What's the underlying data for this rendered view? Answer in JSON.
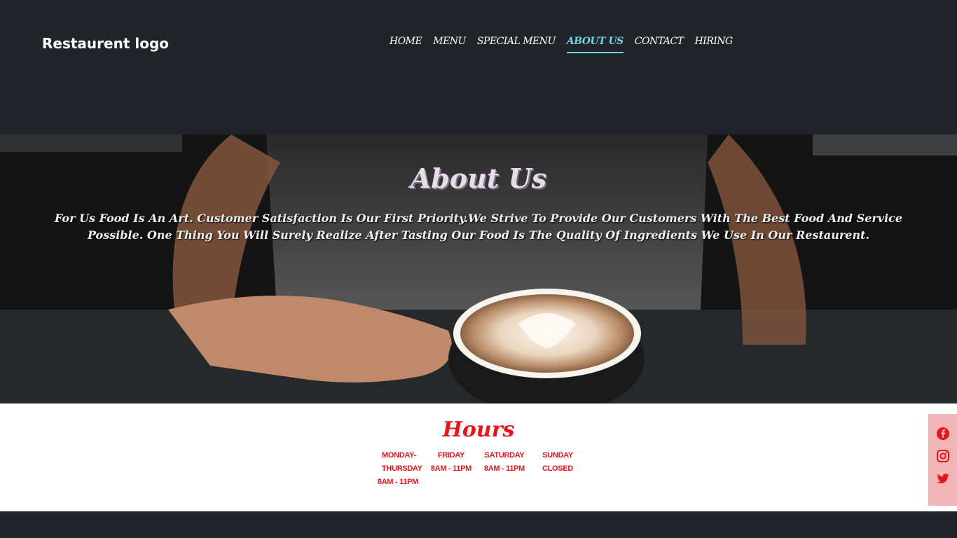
{
  "header": {
    "logo": "Restaurent logo",
    "nav": [
      {
        "label": "HOME"
      },
      {
        "label": "MENU"
      },
      {
        "label": "SPECIAL MENU"
      },
      {
        "label": "ABOUT US"
      },
      {
        "label": "CONTACT"
      },
      {
        "label": "HIRING"
      }
    ],
    "active_index": 3
  },
  "hero": {
    "title": "About Us",
    "text": "For Us Food Is An Art. Customer Satisfaction Is Our First Priority.We Strive To Provide Our Customers With The Best Food And Service Possible. One Thing You Will Surely Realize After Tasting Our Food Is The Quality Of Ingredients We Use In Our Restaurent."
  },
  "hours": {
    "title": "Hours",
    "columns": [
      {
        "days": "MONDAY-THURSDAY",
        "time": "8AM - 11PM"
      },
      {
        "days": "FRIDAY",
        "time": "8AM - 11PM"
      },
      {
        "days": "SATURDAY",
        "time": "8AM - 11PM"
      },
      {
        "days": "SUNDAY",
        "time": "CLOSED"
      }
    ]
  },
  "social": {
    "icons": [
      "facebook-icon",
      "instagram-icon",
      "twitter-icon"
    ]
  },
  "colors": {
    "background": "#212529",
    "accent": "#6fd3e8",
    "hours_red": "#e8141c",
    "social_bar": "#f2b5b6"
  }
}
